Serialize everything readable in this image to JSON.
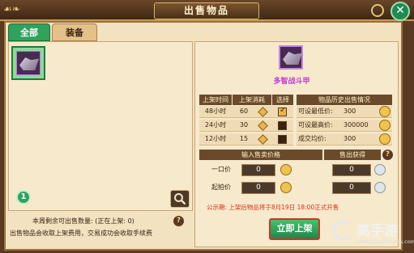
{
  "window": {
    "title": "出售物品",
    "close_label": "✕"
  },
  "tabs": [
    {
      "label": "全部",
      "active": true
    },
    {
      "label": "装备",
      "active": false
    }
  ],
  "inventory": {
    "page_number": "1"
  },
  "notices": {
    "weekly_line": "本周剩余可出售数量:      (正在上架: 0)",
    "fee_line": "出售物品会收取上架费用，交易成功会收取手续费",
    "help_icon": "?"
  },
  "item": {
    "name": "多智战斗甲"
  },
  "listing_table": {
    "headers": [
      "上架时间",
      "上架消耗",
      "选择"
    ],
    "rows": [
      {
        "time": "48小时",
        "cost": "60",
        "selected": true
      },
      {
        "time": "24小时",
        "cost": "30",
        "selected": false
      },
      {
        "time": "12小时",
        "cost": "15",
        "selected": false
      }
    ]
  },
  "history_table": {
    "header": "物品历史出售情况",
    "rows": [
      {
        "label": "可设最低价:",
        "value": "300"
      },
      {
        "label": "可设最高价:",
        "value": "300000"
      },
      {
        "label": "成交均价:",
        "value": "300"
      }
    ]
  },
  "price_section": {
    "input_header": "输入售卖价格",
    "output_header": "售出获得",
    "help_icon": "?",
    "rows": [
      {
        "label": "一口价",
        "input": "0",
        "output": "0"
      },
      {
        "label": "起拍价",
        "input": "0",
        "output": "0"
      }
    ]
  },
  "announcement": "公示期: 上架后物品将于8月19日 18:00正式开售",
  "actions": {
    "list_button": "立即上架"
  },
  "watermark": {
    "text": "高手游",
    "url": "www.gaoshouyou.com"
  },
  "colors": {
    "accent_green": "#2fa25c",
    "item_purple": "#c43ad6",
    "announce_red": "#d8321e"
  }
}
